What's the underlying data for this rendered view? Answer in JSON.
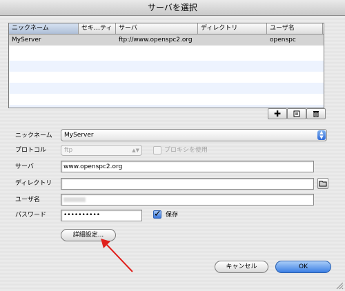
{
  "window": {
    "title": "サーバを選択"
  },
  "table": {
    "columns": [
      "ニックネーム",
      "セキ…ティ",
      "サーバ",
      "ディレクトリ",
      "ユーザ名"
    ],
    "rows": [
      {
        "nickname": "MyServer",
        "security": "",
        "server": "ftp://www.openspc2.org",
        "directory": "",
        "username": "openspc"
      }
    ]
  },
  "toolbar": {
    "add_icon": "plus-icon",
    "edit_icon": "edit-icon",
    "delete_icon": "trash-icon"
  },
  "form": {
    "nickname_label": "ニックネーム",
    "nickname_value": "MyServer",
    "protocol_label": "プロトコル",
    "protocol_value": "ftp",
    "proxy_label": "プロキシを使用",
    "server_label": "サーバ",
    "server_value": "www.openspc2.org",
    "directory_label": "ディレクトリ",
    "directory_value": "",
    "username_label": "ユーザ名",
    "password_label": "パスワード",
    "password_value": "••••••••••",
    "save_label": "保存",
    "advanced_label": "詳細設定..."
  },
  "buttons": {
    "cancel": "キャンセル",
    "ok": "OK"
  },
  "colors": {
    "accent": "#3b7fe4",
    "annotation_arrow": "#e0201c"
  }
}
